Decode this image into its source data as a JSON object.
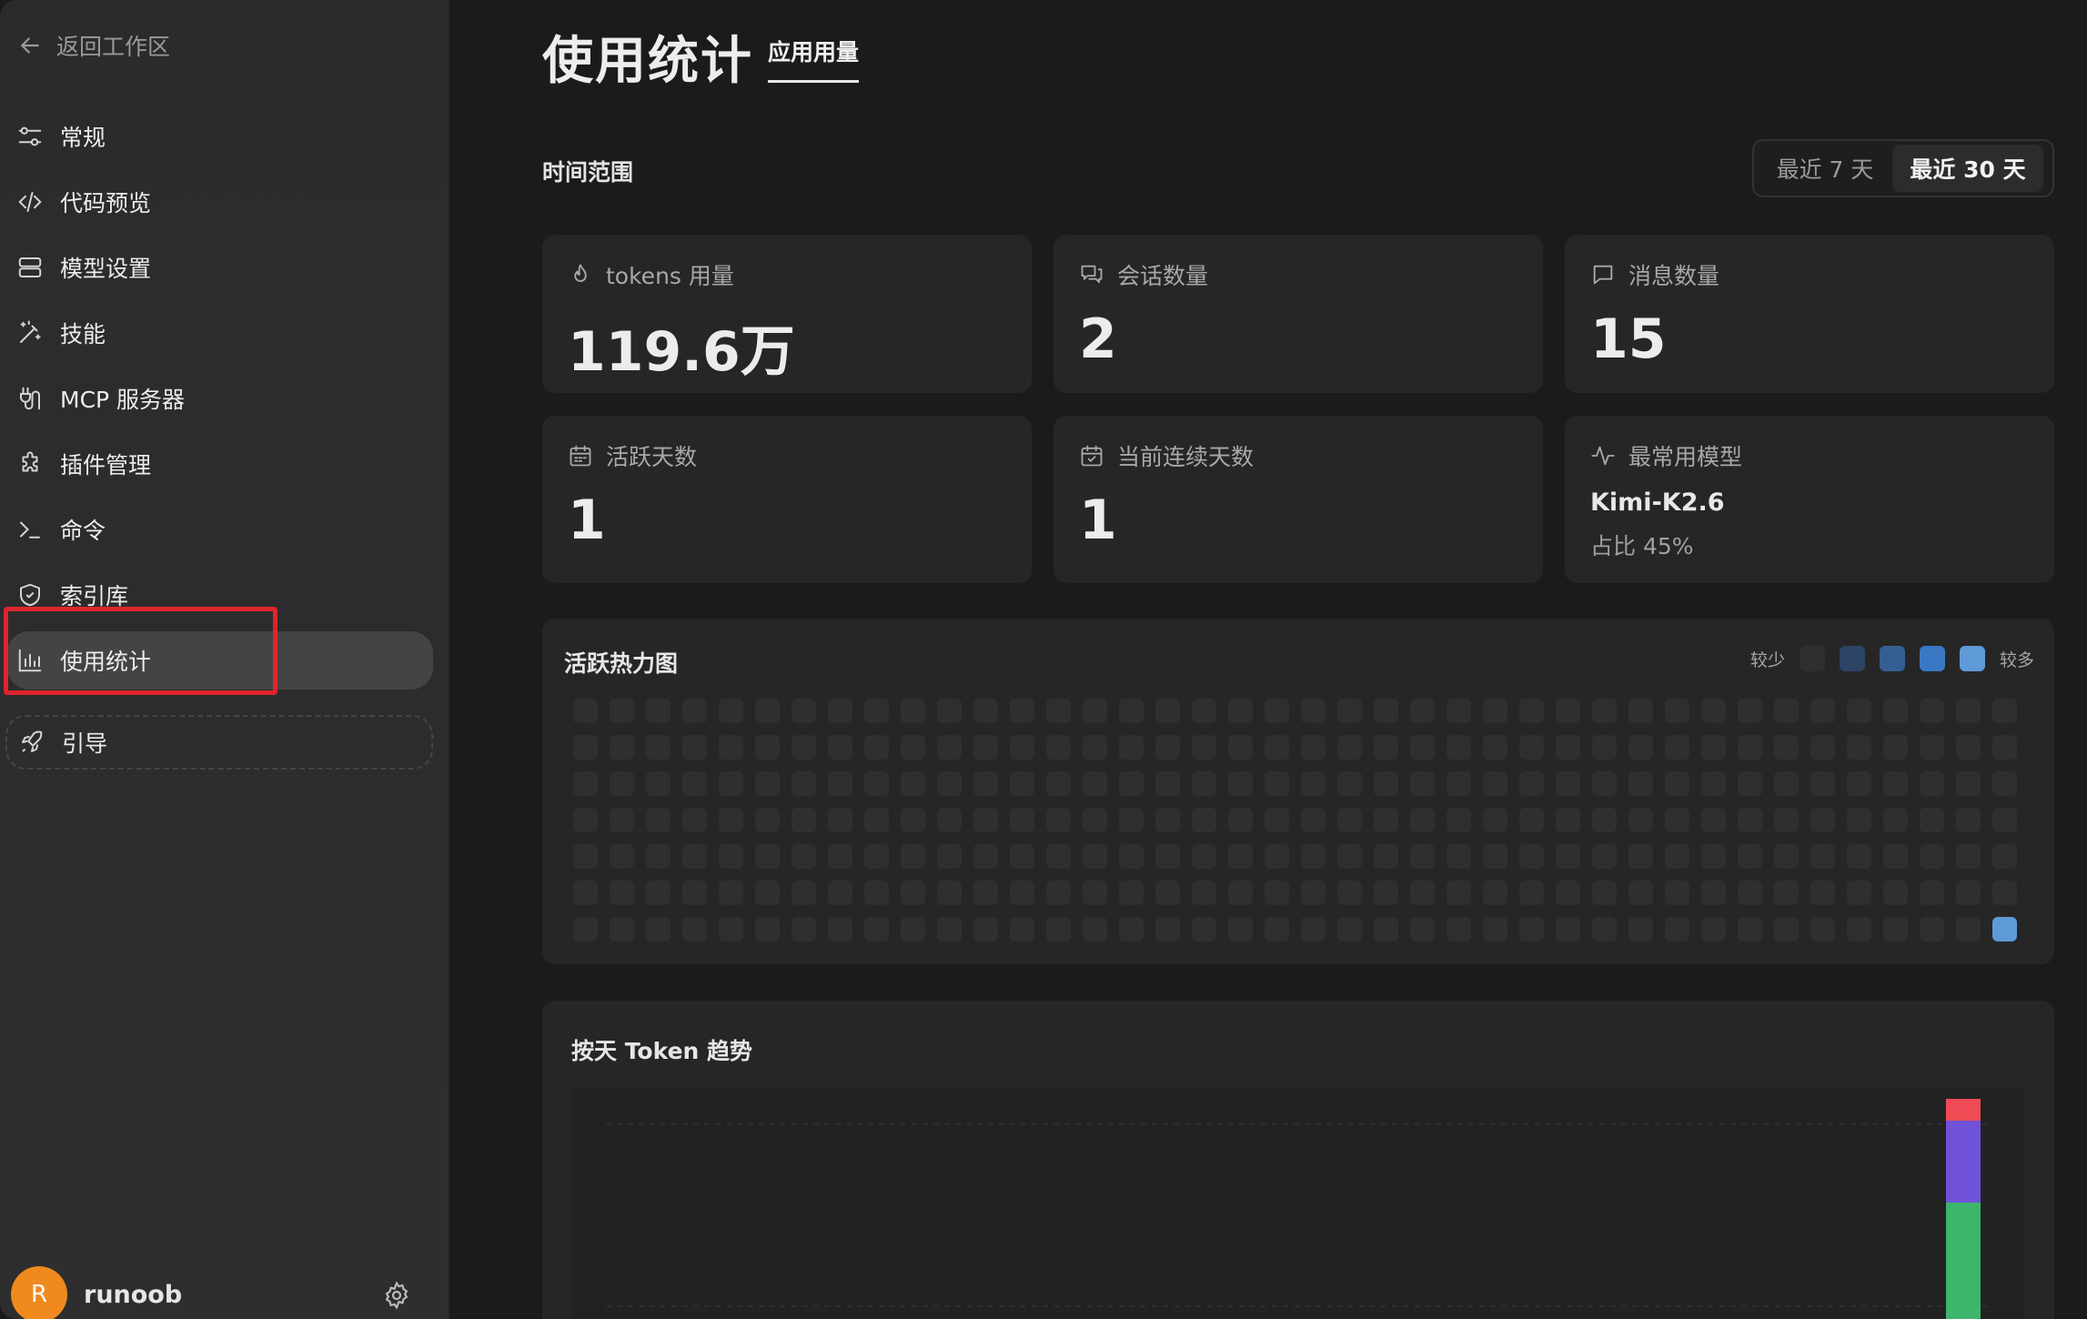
{
  "sidebar": {
    "back_label": "返回工作区",
    "items": [
      {
        "label": "常规",
        "icon": "sliders-icon"
      },
      {
        "label": "代码预览",
        "icon": "code-icon"
      },
      {
        "label": "模型设置",
        "icon": "server-icon"
      },
      {
        "label": "技能",
        "icon": "magic-wand-icon"
      },
      {
        "label": "MCP 服务器",
        "icon": "plug-icon"
      },
      {
        "label": "插件管理",
        "icon": "puzzle-icon"
      },
      {
        "label": "命令",
        "icon": "terminal-icon"
      },
      {
        "label": "索引库",
        "icon": "shield-icon"
      },
      {
        "label": "使用统计",
        "icon": "bar-chart-icon",
        "active": true
      }
    ],
    "guide_label": "引导",
    "user": {
      "avatar_letter": "R",
      "name": "runoob"
    }
  },
  "header": {
    "title": "使用统计",
    "tab": "应用用量"
  },
  "time_range": {
    "label": "时间范围",
    "options": [
      "最近 7 天",
      "最近 30 天"
    ],
    "selected": "最近 30 天"
  },
  "cards": {
    "tokens": {
      "label": "tokens 用量",
      "value": "119.6万"
    },
    "sessions": {
      "label": "会话数量",
      "value": "2"
    },
    "messages": {
      "label": "消息数量",
      "value": "15"
    },
    "active_days": {
      "label": "活跃天数",
      "value": "1"
    },
    "streak": {
      "label": "当前连续天数",
      "value": "1"
    },
    "top_model": {
      "label": "最常用模型",
      "name": "Kimi-K2.6",
      "share": "占比 45%"
    }
  },
  "heatmap": {
    "title": "活跃热力图",
    "legend_less": "较少",
    "legend_more": "较多",
    "legend_colors": [
      "#2f2f2f",
      "#2c4466",
      "#355f93",
      "#3a78c4",
      "#5f9ad8"
    ],
    "weeks": 40,
    "days_per_week": 7,
    "active_cell": {
      "week": 39,
      "day": 6,
      "level": 4
    }
  },
  "trend": {
    "title": "按天 Token 趋势",
    "series_colors": [
      "#3eb56d",
      "#7052d8",
      "#ee4b56"
    ],
    "last_bar_values": [
      0.58,
      0.3,
      0.08
    ]
  }
}
